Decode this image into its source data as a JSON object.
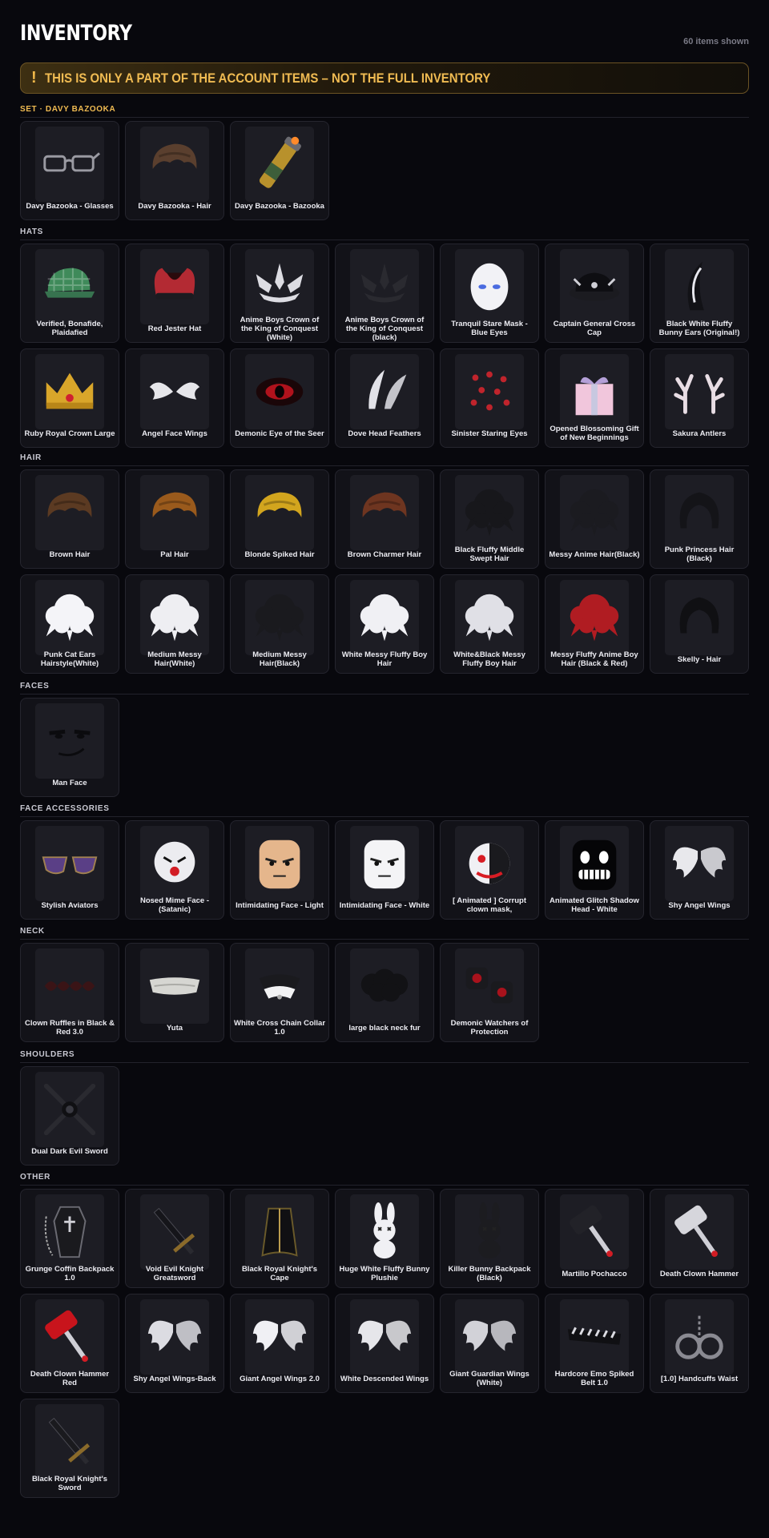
{
  "header": {
    "title": "INVENTORY",
    "count": "60 items shown"
  },
  "warning": {
    "icon": "exclamation-icon",
    "text": "THIS IS ONLY A PART OF THE ACCOUNT ITEMS – NOT THE FULL INVENTORY"
  },
  "sections": [
    {
      "key": "set",
      "title": "SET · DAVY BAZOOKA",
      "items": [
        {
          "name": "Davy Bazooka - Glasses",
          "icon": "glasses-icon"
        },
        {
          "name": "Davy Bazooka - Hair",
          "icon": "hair-icon",
          "color": "#5a3f2e"
        },
        {
          "name": "Davy Bazooka - Bazooka",
          "icon": "bazooka-icon"
        }
      ]
    },
    {
      "key": "hats",
      "title": "HATS",
      "items": [
        {
          "name": "Verified, Bonafide, Plaidafied",
          "icon": "cap-icon",
          "color": "#3f8a5a"
        },
        {
          "name": "Red Jester Hat",
          "icon": "jester-hat-icon",
          "color": "#b32a33"
        },
        {
          "name": "Anime Boys Crown of the King of Conquest (White)",
          "icon": "crown-icon",
          "color": "#dcdce2"
        },
        {
          "name": "Anime Boys Crown of the King of Conquest (black)",
          "icon": "crown-icon",
          "color": "#2a2a30"
        },
        {
          "name": "Tranquil Stare Mask - Blue Eyes",
          "icon": "mask-icon",
          "color": "#f2f2f6"
        },
        {
          "name": "Captain General Cross Cap",
          "icon": "captain-cap-icon",
          "color": "#0e0e12"
        },
        {
          "name": "Black White Fluffy Bunny Ears (Original!)",
          "icon": "bunny-ears-icon",
          "color": "#121216"
        },
        {
          "name": "Ruby Royal Crown Large",
          "icon": "gold-crown-icon",
          "color": "#d9a62a"
        },
        {
          "name": "Angel Face Wings",
          "icon": "face-wings-icon",
          "color": "#e6e6ea"
        },
        {
          "name": "Demonic Eye of the Seer",
          "icon": "demon-eye-icon",
          "color": "#b0121c"
        },
        {
          "name": "Dove Head Feathers",
          "icon": "feathers-icon",
          "color": "#e2e2e8"
        },
        {
          "name": "Sinister Staring Eyes",
          "icon": "staring-eyes-icon",
          "color": "#c0242c"
        },
        {
          "name": "Opened Blossoming Gift of New Beginnings",
          "icon": "gift-icon",
          "color": "#f1c6dc"
        },
        {
          "name": "Sakura Antlers",
          "icon": "antlers-icon",
          "color": "#6b4a3a"
        }
      ]
    },
    {
      "key": "hair",
      "title": "HAIR",
      "items": [
        {
          "name": "Brown Hair",
          "icon": "hair-icon",
          "color": "#5b3a22"
        },
        {
          "name": "Pal Hair",
          "icon": "hair-icon",
          "color": "#9a5a1c"
        },
        {
          "name": "Blonde Spiked Hair",
          "icon": "hair-icon",
          "color": "#d2a51e"
        },
        {
          "name": "Brown Charmer Hair",
          "icon": "hair-icon",
          "color": "#6e3520"
        },
        {
          "name": "Black Fluffy Middle Swept Hair",
          "icon": "fluffy-hair-icon",
          "color": "#17171b"
        },
        {
          "name": "Messy Anime Hair(Black)",
          "icon": "fluffy-hair-icon",
          "color": "#1b1b20"
        },
        {
          "name": "Punk Princess Hair (Black)",
          "icon": "long-hair-icon",
          "color": "#141418"
        },
        {
          "name": "Punk Cat Ears Hairstyle(White)",
          "icon": "fluffy-hair-icon",
          "color": "#f4f4f8"
        },
        {
          "name": "Medium Messy Hair(White)",
          "icon": "fluffy-hair-icon",
          "color": "#eeeef2"
        },
        {
          "name": "Medium Messy Hair(Black)",
          "icon": "fluffy-hair-icon",
          "color": "#1a1a1e"
        },
        {
          "name": "White Messy Fluffy Boy Hair",
          "icon": "fluffy-hair-icon",
          "color": "#f0f0f4"
        },
        {
          "name": "White&Black Messy Fluffy Boy Hair",
          "icon": "fluffy-hair-icon",
          "color": "#e0e0e6"
        },
        {
          "name": "Messy Fluffy Anime Boy Hair (Black & Red)",
          "icon": "fluffy-hair-icon",
          "color": "#b01c22"
        },
        {
          "name": "Skelly - Hair",
          "icon": "long-hair-icon",
          "color": "#101013"
        }
      ]
    },
    {
      "key": "faces",
      "title": "FACES",
      "items": [
        {
          "name": "Man Face",
          "icon": "face-icon",
          "color": "#0b0b0e"
        }
      ]
    },
    {
      "key": "face-accessories",
      "title": "FACE ACCESSORIES",
      "items": [
        {
          "name": "Stylish Aviators",
          "icon": "aviators-icon",
          "color": "#5a3f86"
        },
        {
          "name": "Nosed Mime Face - (Satanic)",
          "icon": "mime-face-icon",
          "color": "#ececf0"
        },
        {
          "name": "Intimidating Face - Light",
          "icon": "head-icon",
          "color": "#e5b68c"
        },
        {
          "name": "Intimidating Face - White",
          "icon": "head-icon",
          "color": "#f4f4f6"
        },
        {
          "name": "[ Animated ] Corrupt clown mask,",
          "icon": "clown-mask-icon",
          "color": "#d81c24"
        },
        {
          "name": "Animated Glitch Shadow Head - White",
          "icon": "shadow-head-icon",
          "color": "#050507"
        },
        {
          "name": "Shy Angel Wings",
          "icon": "wings-icon",
          "color": "#e8e8ec"
        }
      ]
    },
    {
      "key": "neck",
      "title": "NECK",
      "items": [
        {
          "name": "Clown Ruffles in Black & Red 3.0",
          "icon": "ruffles-icon",
          "color": "#3a1416"
        },
        {
          "name": "Yuta",
          "icon": "scarf-icon",
          "color": "#d6d6d2"
        },
        {
          "name": "White Cross Chain Collar 1.0",
          "icon": "collar-icon",
          "color": "#f2f2f4"
        },
        {
          "name": "large black neck fur",
          "icon": "fur-icon",
          "color": "#121215"
        },
        {
          "name": "Demonic Watchers of Protection",
          "icon": "watchers-icon",
          "color": "#a8121c"
        }
      ]
    },
    {
      "key": "shoulders",
      "title": "SHOULDERS",
      "items": [
        {
          "name": "Dual Dark Evil Sword",
          "icon": "crossed-swords-icon",
          "color": "#101013"
        }
      ]
    },
    {
      "key": "other",
      "title": "OTHER",
      "items": [
        {
          "name": "Grunge Coffin Backpack 1.0",
          "icon": "coffin-icon",
          "color": "#1a1a1e"
        },
        {
          "name": "Void Evil Knight Greatsword",
          "icon": "sword-icon",
          "color": "#15151a"
        },
        {
          "name": "Black Royal Knight's Cape",
          "icon": "cape-icon",
          "color": "#101013"
        },
        {
          "name": "Huge White Fluffy Bunny Plushie",
          "icon": "bunny-plush-icon",
          "color": "#f0f0f4"
        },
        {
          "name": "Killer Bunny Backpack (Black)",
          "icon": "bunny-plush-icon",
          "color": "#1c1c20"
        },
        {
          "name": "Martillo Pochacco",
          "icon": "hammer-icon",
          "color": "#222228"
        },
        {
          "name": "Death Clown Hammer",
          "icon": "hammer-icon",
          "color": "#d6d6dc"
        },
        {
          "name": "Death Clown Hammer Red",
          "icon": "hammer-icon",
          "color": "#c8141c"
        },
        {
          "name": "Shy Angel Wings-Back",
          "icon": "wings-icon",
          "color": "#dcdce2"
        },
        {
          "name": "Giant Angel Wings 2.0",
          "icon": "wings-icon",
          "color": "#f0f0f4"
        },
        {
          "name": "White Descended Wings",
          "icon": "wings-icon",
          "color": "#e6e6ea"
        },
        {
          "name": "Giant Guardian Wings (White)",
          "icon": "wings-icon",
          "color": "#d2d2d8"
        },
        {
          "name": "Hardcore Emo Spiked Belt 1.0",
          "icon": "belt-icon",
          "color": "#101013"
        },
        {
          "name": "[1.0] Handcuffs Waist",
          "icon": "handcuffs-icon",
          "color": "#8a8a92"
        },
        {
          "name": "Black Royal Knight's Sword",
          "icon": "sword-icon",
          "color": "#1a1a1e"
        }
      ]
    }
  ]
}
